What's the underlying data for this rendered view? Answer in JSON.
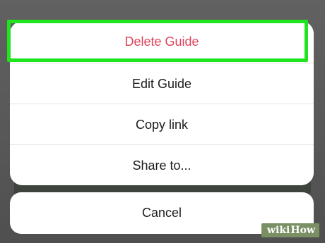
{
  "action_sheet": {
    "items": [
      {
        "label": "Delete Guide",
        "destructive": true
      },
      {
        "label": "Edit Guide"
      },
      {
        "label": "Copy link"
      },
      {
        "label": "Share to..."
      }
    ],
    "cancel_label": "Cancel"
  },
  "highlight": {
    "color": "#1ee51e",
    "target": "Delete Guide"
  },
  "colors": {
    "destructive": "#e0435b",
    "text": "#1c1c1c",
    "backdrop": "#5b5b5b"
  },
  "watermark": {
    "part1": "wiki",
    "part2": "How"
  }
}
